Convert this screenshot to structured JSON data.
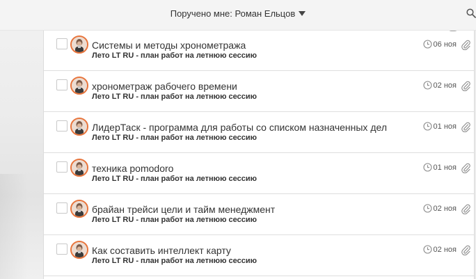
{
  "header": {
    "title": "Поручено мне: Роман Ельцов"
  },
  "tasks": [
    {
      "title": "Системы и методы хронометража",
      "project": "Лето LT RU - план работ на летнюю сессию",
      "due": "06 ноя"
    },
    {
      "title": "хронометраж рабочего времени",
      "project": "Лето LT RU - план работ на летнюю сессию",
      "due": "02 ноя"
    },
    {
      "title": "ЛидерТаск - программа для работы со списком назначенных дел",
      "project": "Лето LT RU - план работ на летнюю сессию",
      "due": "01 ноя"
    },
    {
      "title": "техника pomodoro",
      "project": "Лето LT RU - план работ на летнюю сессию",
      "due": "01 ноя"
    },
    {
      "title": "брайан трейси цели и тайм менеджмент",
      "project": "Лето LT RU - план работ на летнюю сессию",
      "due": "02 ноя"
    },
    {
      "title": "Как составить интеллект карту",
      "project": "Лето LT RU - план работ на летнюю сессию",
      "due": "02 ноя"
    }
  ],
  "colors": {
    "avatar_ring": "#e8743b",
    "text": "#333333",
    "divider": "#dedede"
  },
  "icons": {
    "header": [
      "chevron-down-icon",
      "search-icon"
    ],
    "row": [
      "checkbox",
      "avatar",
      "clock-icon",
      "paperclip-icon"
    ]
  }
}
